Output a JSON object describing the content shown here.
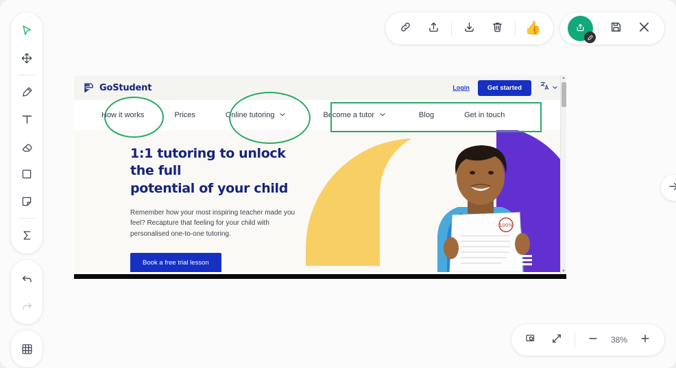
{
  "app": {
    "background_color": "#eceef0",
    "panel_color": "#fbfbfc"
  },
  "left_toolbar": {
    "tools": [
      {
        "name": "select-tool",
        "icon": "cursor-arrow-icon",
        "state": "active"
      },
      {
        "name": "move-tool",
        "icon": "move-arrows-icon",
        "state": "default"
      },
      {
        "name": "pen-tool",
        "icon": "pen-icon",
        "state": "default"
      },
      {
        "name": "text-tool",
        "icon": "text-t-icon",
        "state": "default"
      },
      {
        "name": "eraser-tool",
        "icon": "eraser-icon",
        "state": "default"
      },
      {
        "name": "rectangle-tool",
        "icon": "square-icon",
        "state": "default"
      },
      {
        "name": "note-tool",
        "icon": "sticky-note-icon",
        "state": "default"
      },
      {
        "name": "sum-tool",
        "icon": "sigma-icon",
        "state": "default"
      }
    ],
    "history": [
      {
        "name": "undo-button",
        "icon": "undo-arrow-icon",
        "state": "default"
      },
      {
        "name": "redo-button",
        "icon": "redo-arrow-icon",
        "state": "disabled"
      }
    ],
    "grid": {
      "name": "grid-button",
      "icon": "grid-icon",
      "state": "default"
    },
    "active_color": "#2bb673"
  },
  "top_toolbar": {
    "actions": [
      {
        "name": "copy-link-button",
        "icon": "link-chain-icon"
      },
      {
        "name": "share-button",
        "icon": "upload-arrow-icon"
      },
      {
        "name": "download-button",
        "icon": "download-arrow-icon"
      },
      {
        "name": "delete-button",
        "icon": "trash-icon"
      },
      {
        "name": "reaction-button",
        "icon": "thumbs-up-icon",
        "glyph": "👍"
      }
    ],
    "right_group": [
      {
        "name": "annotate-share-button",
        "icon": "share-edit-icon",
        "badge_icon": "pencil-icon",
        "color": "#11a87a"
      },
      {
        "name": "save-button",
        "icon": "floppy-disk-icon"
      },
      {
        "name": "close-button",
        "icon": "close-x-icon"
      }
    ]
  },
  "canvas": {
    "right_nav": {
      "name": "next-arrow-button",
      "icon": "arrow-right-icon"
    },
    "screenshot": {
      "site": {
        "brand": "GoStudent",
        "header": {
          "login_label": "Login",
          "cta_label": "Get started",
          "language_icon": "translate-icon",
          "language_chevron_icon": "chevron-down-icon"
        },
        "nav_items": [
          {
            "label": "How it works",
            "has_chevron": false
          },
          {
            "label": "Prices",
            "has_chevron": false
          },
          {
            "label": "Online tutoring",
            "has_chevron": true
          },
          {
            "label": "Become a tutor",
            "has_chevron": true
          },
          {
            "label": "Blog",
            "has_chevron": false
          },
          {
            "label": "Get in touch",
            "has_chevron": false
          }
        ],
        "hero": {
          "heading_line1": "1:1 tutoring to unlock the full",
          "heading_line2": "potential of your child",
          "paragraph": "Remember how your most inspiring teacher made you feel? Recapture that feeling for your child with personalised one-to-one tutoring.",
          "cta_label": "Book a free trial lesson",
          "heading_color": "#16247a",
          "cta_color": "#1630c4",
          "shape_yellow": "#f7cf64",
          "shape_purple": "#6230d0"
        }
      },
      "annotations": {
        "color": "#26ab62",
        "shapes": [
          {
            "name": "annotation-ellipse-how-it-works",
            "type": "ellipse",
            "target_label": "How it works"
          },
          {
            "name": "annotation-ellipse-online-tutoring",
            "type": "ellipse",
            "target_label": "Online tutoring"
          },
          {
            "name": "annotation-rect-nav-right",
            "type": "rectangle",
            "target_label": "Become a tutor / Blog / Get in touch"
          }
        ]
      }
    }
  },
  "zoom_bar": {
    "fit_button": {
      "name": "screenshot-mode-button",
      "icon": "screen-capture-icon"
    },
    "expand_button": {
      "name": "fullscreen-button",
      "icon": "expand-diagonal-icon"
    },
    "zoom_out": {
      "name": "zoom-out-button",
      "label": "−"
    },
    "zoom_in": {
      "name": "zoom-in-button",
      "label": "+"
    },
    "zoom_level": "38%"
  }
}
